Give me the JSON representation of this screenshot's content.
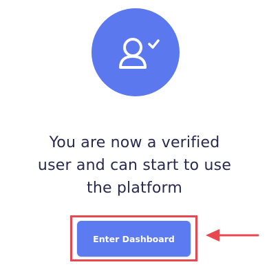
{
  "verification": {
    "message_lines": [
      "You are now a verified",
      "user and can start to use",
      "the platform"
    ],
    "button_label": "Enter Dashboard"
  },
  "icons": {
    "avatar": "user-check-icon",
    "pointer": "arrow-left-icon"
  },
  "colors": {
    "accent": "#5b78ef",
    "text": "#2a2850",
    "highlight": "#e8474f"
  }
}
